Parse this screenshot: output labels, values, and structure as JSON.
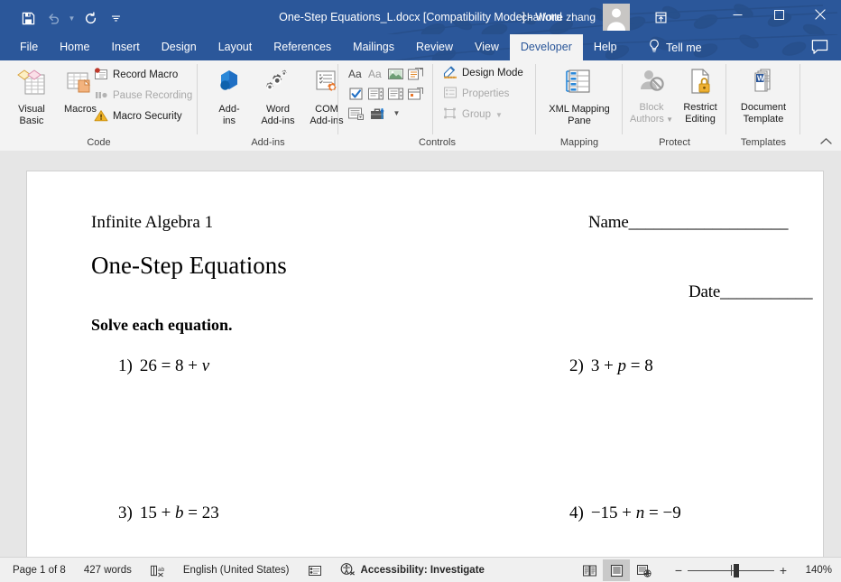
{
  "titlebar": {
    "document_title": "One-Step Equations_L.docx [Compatibility Mode]  -  Word",
    "account_name": "charlotte zhang",
    "quick_access": [
      {
        "name": "save",
        "label": "Save"
      },
      {
        "name": "undo",
        "label": "Undo"
      },
      {
        "name": "redo",
        "label": "Redo"
      },
      {
        "name": "customize-quick-access-toolbar",
        "label": "Customize Quick Access Toolbar"
      }
    ],
    "window_controls": [
      {
        "name": "ribbon-display-options",
        "label": "Ribbon Display Options"
      },
      {
        "name": "minimize",
        "label": "Minimize"
      },
      {
        "name": "restore",
        "label": "Restore Down"
      },
      {
        "name": "close",
        "label": "Close"
      }
    ]
  },
  "tabs": [
    {
      "label": "File",
      "active": false
    },
    {
      "label": "Home",
      "active": false
    },
    {
      "label": "Insert",
      "active": false
    },
    {
      "label": "Design",
      "active": false
    },
    {
      "label": "Layout",
      "active": false
    },
    {
      "label": "References",
      "active": false
    },
    {
      "label": "Mailings",
      "active": false
    },
    {
      "label": "Review",
      "active": false
    },
    {
      "label": "View",
      "active": false
    },
    {
      "label": "Developer",
      "active": true
    },
    {
      "label": "Help",
      "active": false
    }
  ],
  "tellme": {
    "label": "Tell me",
    "icon": "lightbulb-icon"
  },
  "share": {
    "label": "Comments",
    "icon": "comment-icon"
  },
  "ribbon": {
    "collapse_label": "Collapse the Ribbon",
    "groups": [
      {
        "name": "code",
        "label": "Code",
        "big_buttons": [
          {
            "name": "visual-basic",
            "label": "Visual\nBasic",
            "line1": "Visual",
            "line2": "Basic",
            "disabled": false
          },
          {
            "name": "macros",
            "label": "Macros",
            "line1": "Macros",
            "line2": "",
            "disabled": false
          }
        ],
        "small_buttons": [
          {
            "name": "record-macro",
            "label": "Record Macro",
            "disabled": false
          },
          {
            "name": "pause-recording",
            "label": "Pause Recording",
            "disabled": true
          },
          {
            "name": "macro-security",
            "label": "Macro Security",
            "disabled": false
          }
        ]
      },
      {
        "name": "add-ins",
        "label": "Add-ins",
        "big_buttons": [
          {
            "name": "add-ins",
            "line1": "Add-",
            "line2": "ins",
            "disabled": false
          },
          {
            "name": "word-add-ins",
            "line1": "Word",
            "line2": "Add-ins",
            "disabled": false
          },
          {
            "name": "com-add-ins",
            "line1": "COM",
            "line2": "Add-ins",
            "disabled": false
          }
        ]
      },
      {
        "name": "controls",
        "label": "Controls",
        "control_icons": [
          {
            "name": "rich-text-content-control"
          },
          {
            "name": "plain-text-content-control"
          },
          {
            "name": "picture-content-control"
          },
          {
            "name": "building-block-gallery-content-control"
          },
          {
            "name": "check-box-content-control"
          },
          {
            "name": "combo-box-content-control"
          },
          {
            "name": "drop-down-list-content-control"
          },
          {
            "name": "date-picker-content-control"
          },
          {
            "name": "repeating-section-content-control"
          },
          {
            "name": "legacy-tools"
          }
        ],
        "small_buttons": [
          {
            "name": "design-mode",
            "label": "Design Mode",
            "disabled": false
          },
          {
            "name": "properties",
            "label": "Properties",
            "disabled": true
          },
          {
            "name": "group",
            "label": "Group",
            "disabled": true
          }
        ]
      },
      {
        "name": "mapping",
        "label": "Mapping",
        "big_buttons": [
          {
            "name": "xml-mapping-pane",
            "line1": "XML Mapping",
            "line2": "Pane",
            "disabled": false
          }
        ]
      },
      {
        "name": "protect",
        "label": "Protect",
        "big_buttons": [
          {
            "name": "block-authors",
            "line1": "Block",
            "line2": "Authors",
            "disabled": true
          },
          {
            "name": "restrict-editing",
            "line1": "Restrict",
            "line2": "Editing",
            "disabled": false
          }
        ]
      },
      {
        "name": "templates",
        "label": "Templates",
        "big_buttons": [
          {
            "name": "document-template",
            "line1": "Document",
            "line2": "Template",
            "disabled": false
          }
        ]
      }
    ]
  },
  "document": {
    "header_left": "Infinite Algebra 1",
    "name_field": "Name___________________",
    "title": "One-Step Equations",
    "date_field": "Date___________",
    "instruction": "Solve each equation.",
    "problems": [
      {
        "number": "1)",
        "lhs": "26 = 8 + ",
        "var": "v",
        "rhs": ""
      },
      {
        "number": "2)",
        "lhs": "3 + ",
        "var": "p",
        "rhs": " = 8"
      },
      {
        "number": "3)",
        "lhs": "15 + ",
        "var": "b",
        "rhs": " = 23"
      },
      {
        "number": "4)",
        "lhs": "−15 + ",
        "var": "n",
        "rhs": " = −9"
      }
    ]
  },
  "statusbar": {
    "page": "Page 1 of 8",
    "words": "427 words",
    "proofing_icon": "spelling-and-grammar-check-icon",
    "language": "English (United States)",
    "macro_icon": "macro-recording-icon",
    "accessibility": "Accessibility: Investigate",
    "views": [
      {
        "name": "read-mode",
        "label": "Read Mode",
        "active": false
      },
      {
        "name": "print-layout",
        "label": "Print Layout",
        "active": true
      },
      {
        "name": "web-layout",
        "label": "Web Layout",
        "active": false
      }
    ],
    "zoom_out_label": "−",
    "zoom_in_label": "+",
    "zoom_level": "140%"
  },
  "colors": {
    "word_blue": "#2b579a",
    "ribbon_bg": "#f3f3f3",
    "statusbar_bg": "#f0f0f0",
    "page_bg": "#ffffff",
    "canvas_bg": "#e6e6e6"
  }
}
